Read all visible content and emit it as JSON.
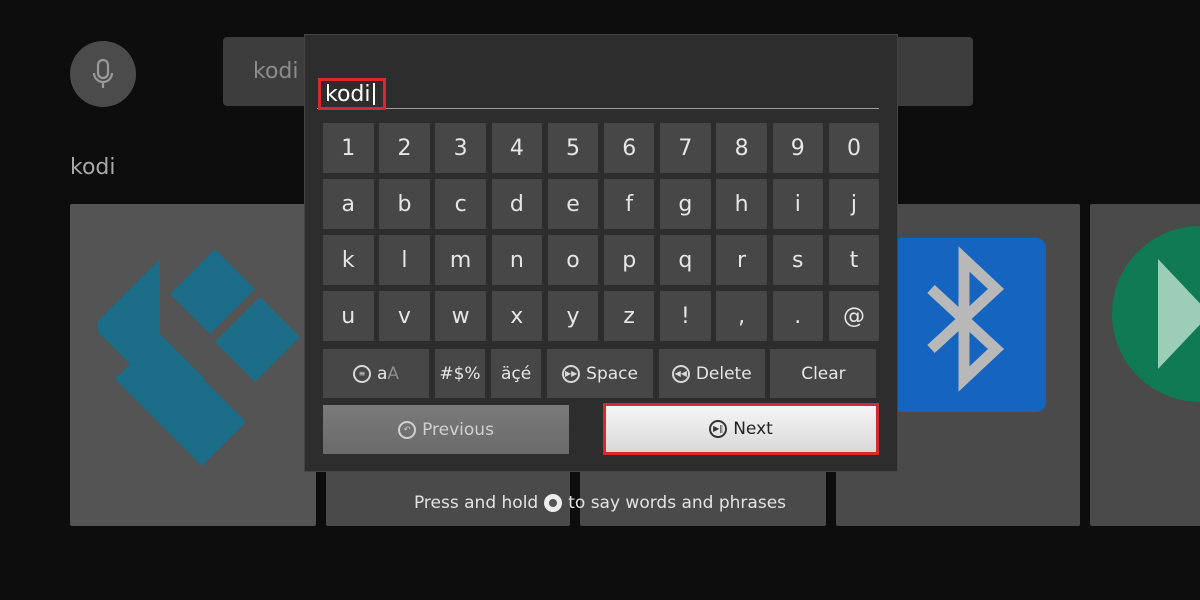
{
  "search": {
    "query": "kodi",
    "results_label": "kodi"
  },
  "keyboard": {
    "input_value": "kodi",
    "keys": [
      "1",
      "2",
      "3",
      "4",
      "5",
      "6",
      "7",
      "8",
      "9",
      "0",
      "a",
      "b",
      "c",
      "d",
      "e",
      "f",
      "g",
      "h",
      "i",
      "j",
      "k",
      "l",
      "m",
      "n",
      "o",
      "p",
      "q",
      "r",
      "s",
      "t",
      "u",
      "v",
      "w",
      "x",
      "y",
      "z",
      "!",
      ",",
      ".",
      "@"
    ],
    "function_keys": {
      "case_small": "a",
      "case_big": "A",
      "symbols": "#$%",
      "accents": "äçé",
      "space": "Space",
      "delete": "Delete",
      "clear": "Clear"
    },
    "previous_label": "Previous",
    "next_label": "Next"
  },
  "voice_hint": {
    "before": "Press and hold",
    "after": "to say words and phrases"
  },
  "colors": {
    "highlight": "#d7282f",
    "kodi_blue": "#1b6d88",
    "bluetooth_blue": "#1565c0",
    "play_green": "#0f7a54"
  },
  "icons": {
    "mic": "microphone-icon",
    "menu": "menu-icon",
    "space": "fast-forward-icon",
    "delete": "rewind-icon",
    "previous": "back-icon",
    "next": "play-pause-icon"
  }
}
